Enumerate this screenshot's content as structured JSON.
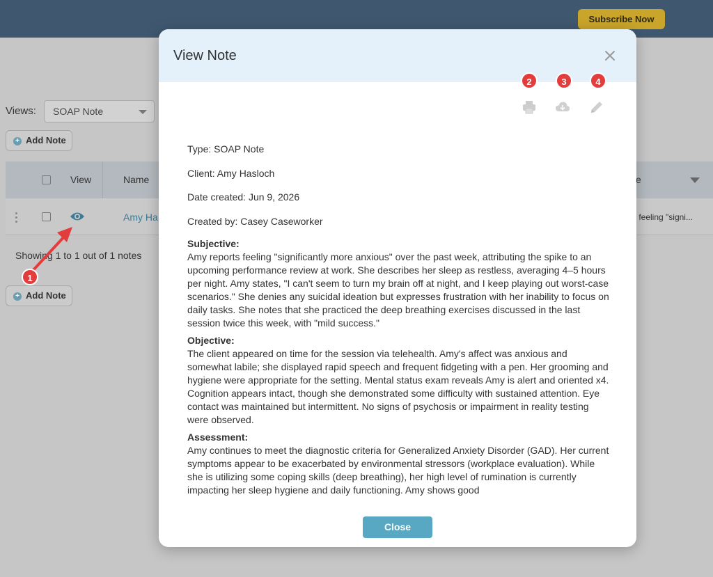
{
  "topbar": {
    "subscribe_label": "Subscribe Now"
  },
  "page": {
    "views_label": "Views:",
    "views_selected": "SOAP Note",
    "add_note_label": "Add Note",
    "table": {
      "headers": {
        "view": "View",
        "name": "Name",
        "last": "e"
      },
      "row": {
        "name": "Amy Ha",
        "summary": "s feeling \"signi..."
      }
    },
    "showing_text": "Showing 1 to 1 out of 1 notes"
  },
  "annotations": [
    "1",
    "2",
    "3",
    "4"
  ],
  "modal": {
    "title": "View Note",
    "meta": {
      "type": "Type: SOAP Note",
      "client": "Client: Amy Hasloch",
      "date": "Date created: Jun 9, 2026",
      "created_by": "Created by: Casey Caseworker"
    },
    "sections": [
      {
        "title": "Subjective:",
        "text": "Amy reports feeling \"significantly more anxious\" over the past week, attributing the spike to an upcoming performance review at work. She describes her sleep as restless, averaging 4–5 hours per night. Amy states, \"I can't seem to turn my brain off at night, and I keep playing out worst-case scenarios.\" She denies any suicidal ideation but expresses frustration with her inability to focus on daily tasks. She notes that she practiced the deep breathing exercises discussed in the last session twice this week, with \"mild success.\""
      },
      {
        "title": "Objective:",
        "text": "The client appeared on time for the session via telehealth. Amy's affect was anxious and somewhat labile; she displayed rapid speech and frequent fidgeting with a pen. Her grooming and hygiene were appropriate for the setting. Mental status exam reveals Amy is alert and oriented x4. Cognition appears intact, though she demonstrated some difficulty with sustained attention. Eye contact was maintained but intermittent. No signs of psychosis or impairment in reality testing were observed."
      },
      {
        "title": "Assessment:",
        "text": "Amy continues to meet the diagnostic criteria for Generalized Anxiety Disorder (GAD). Her current symptoms appear to be exacerbated by environmental stressors (workplace evaluation). While she is utilizing some coping skills (deep breathing), her high level of rumination is currently impacting her sleep hygiene and daily functioning. Amy shows good"
      }
    ],
    "close_label": "Close",
    "icons": [
      "print-icon",
      "cloud-download-icon",
      "pencil-icon",
      "close-icon"
    ]
  },
  "colors": {
    "topbar": "#3f5870",
    "subscribe": "#c9a52b",
    "accent": "#58a8c3",
    "badge": "#e23c3c",
    "modal_header": "#e4f1fb"
  }
}
